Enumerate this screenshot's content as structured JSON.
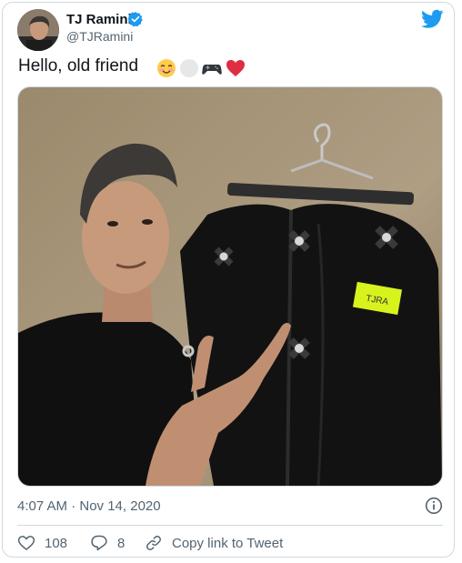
{
  "author": {
    "name": "TJ Ramini",
    "handle": "@TJRamini",
    "verified": true
  },
  "tweet": {
    "text": "Hello, old friend",
    "emojis": [
      "smiling-face-with-blush-icon",
      "white-circle-icon",
      "video-game-controller-icon",
      "red-heart-icon"
    ],
    "photo": {
      "subject": "man-pointing-at-motion-capture-suit",
      "tag_text": "TJRA",
      "tag_color": "#d8f21d"
    },
    "timestamp": "4:07 AM · Nov 14, 2020"
  },
  "actions": {
    "likes": "108",
    "replies": "8",
    "copy_link_label": "Copy link to Tweet"
  },
  "colors": {
    "accent": "#1d9bf0",
    "text": "#0f1419",
    "secondary": "#536471",
    "border": "#cfd9de"
  }
}
